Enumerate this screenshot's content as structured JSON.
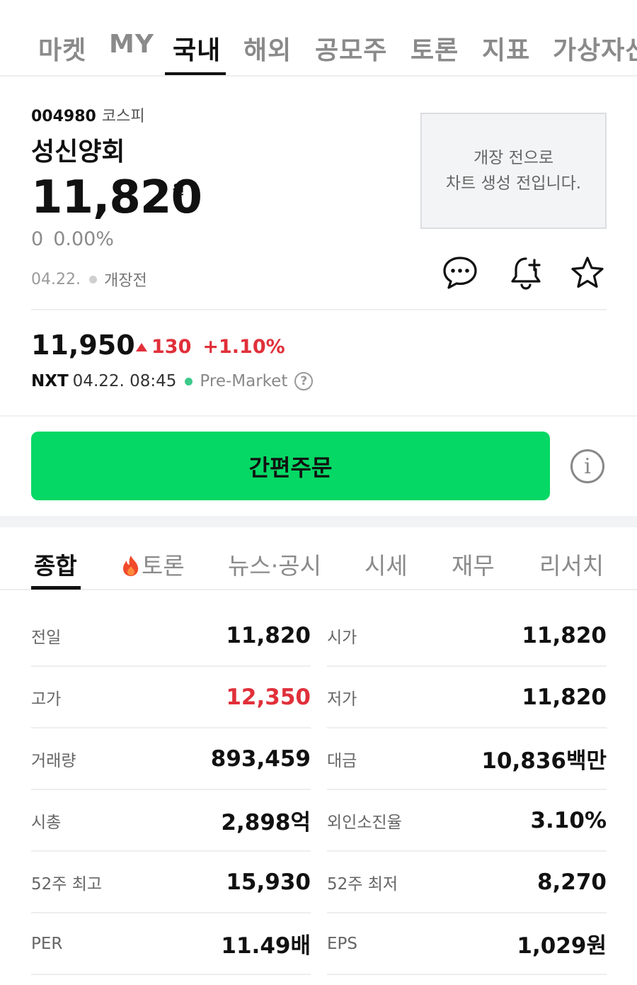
{
  "nav": {
    "tabs": [
      {
        "label": "마켓"
      },
      {
        "label": "MY"
      },
      {
        "label": "국내"
      },
      {
        "label": "해외"
      },
      {
        "label": "공모주"
      },
      {
        "label": "토론"
      },
      {
        "label": "지표"
      },
      {
        "label": "가상자산"
      }
    ],
    "active": "국내"
  },
  "stock": {
    "code": "004980",
    "market": "코스피",
    "name": "성신양회",
    "price": "11,820",
    "price_unit": "원",
    "change": "0",
    "change_pct": "0.00%",
    "date": "04.22.",
    "state": "개장전"
  },
  "chart_placeholder": {
    "line1": "개장 전으로",
    "line2": "차트 생성 전입니다."
  },
  "nxt": {
    "price": "11,950",
    "change": "130",
    "change_pct": "+1.10%",
    "label": "NXT",
    "datetime": "04.22. 08:45",
    "session": "Pre-Market",
    "help": "?"
  },
  "order": {
    "button_label": "간편주문",
    "info_label": "i"
  },
  "subtabs": [
    {
      "label": "종합"
    },
    {
      "label": "토론"
    },
    {
      "label": "뉴스·공시"
    },
    {
      "label": "시세"
    },
    {
      "label": "재무"
    },
    {
      "label": "리서치"
    }
  ],
  "stats": [
    {
      "l_label": "전일",
      "l_value": "11,820",
      "r_label": "시가",
      "r_value": "11,820"
    },
    {
      "l_label": "고가",
      "l_value": "12,350",
      "r_label": "저가",
      "r_value": "11,820"
    },
    {
      "l_label": "거래량",
      "l_value": "893,459",
      "r_label": "대금",
      "r_value": "10,836백만"
    },
    {
      "l_label": "시총",
      "l_value": "2,898억",
      "r_label": "외인소진율",
      "r_value": "3.10%"
    },
    {
      "l_label": "52주 최고",
      "l_value": "15,930",
      "r_label": "52주 최저",
      "r_value": "8,270"
    },
    {
      "l_label": "PER",
      "l_value": "11.49배",
      "r_label": "EPS",
      "r_value": "1,029원"
    }
  ],
  "colors": {
    "accent_green": "#05d864",
    "up_red": "#e0303a",
    "live_green": "#3cc98a"
  },
  "icons": [
    "chat-icon",
    "bell-plus-icon",
    "star-icon",
    "fire-icon",
    "info-icon",
    "help-icon"
  ]
}
